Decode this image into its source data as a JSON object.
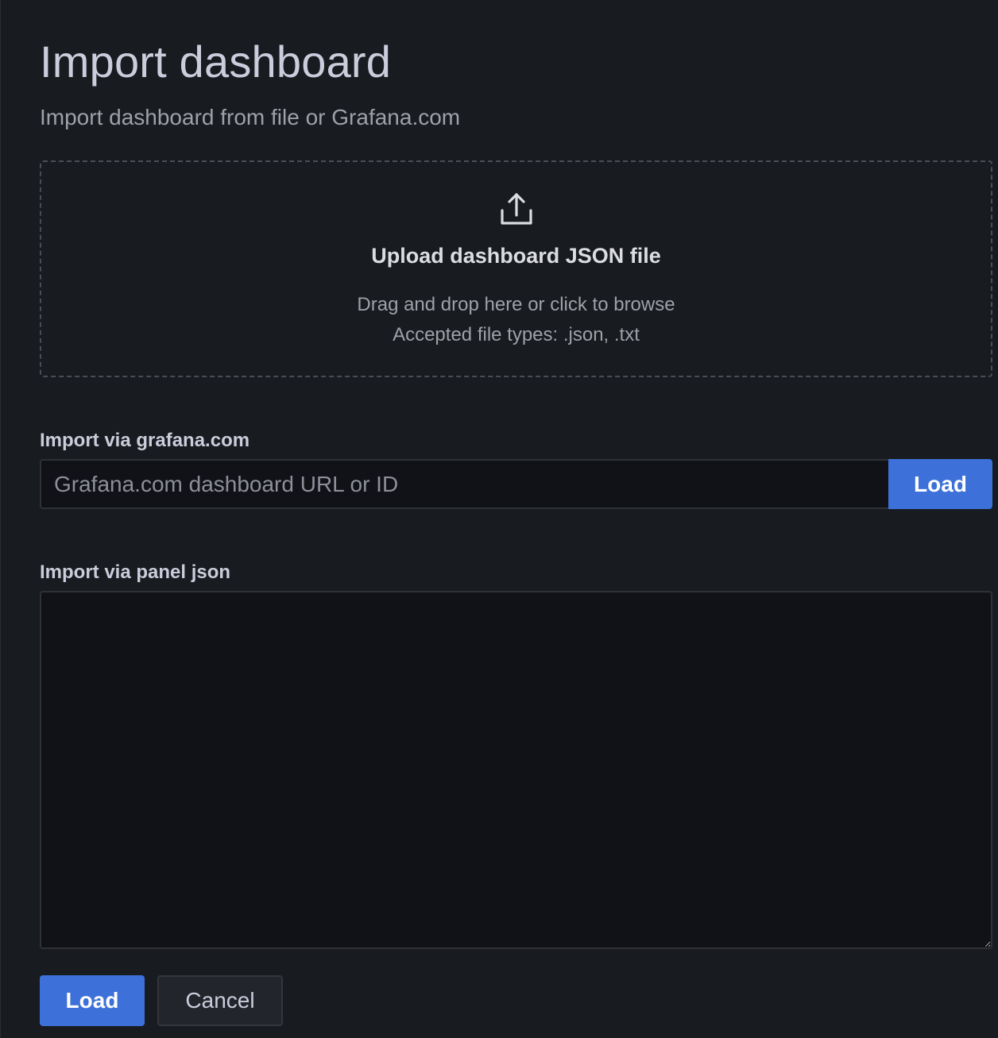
{
  "header": {
    "title": "Import dashboard",
    "subtitle": "Import dashboard from file or Grafana.com"
  },
  "upload": {
    "icon": "upload-icon",
    "title": "Upload dashboard JSON file",
    "hint_line1": "Drag and drop here or click to browse",
    "hint_line2": "Accepted file types: .json, .txt"
  },
  "grafana_com": {
    "label": "Import via grafana.com",
    "value": "",
    "placeholder": "Grafana.com dashboard URL or ID",
    "load_label": "Load"
  },
  "panel_json": {
    "label": "Import via panel json",
    "value": ""
  },
  "footer": {
    "load_label": "Load",
    "cancel_label": "Cancel"
  },
  "colors": {
    "background": "#181b1f",
    "input_background": "#111217",
    "primary": "#3d71d9",
    "text": "#ccccdc",
    "muted_text": "#9fa1a8"
  }
}
